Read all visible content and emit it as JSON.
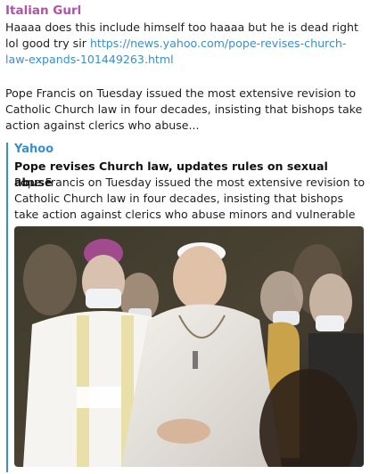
{
  "message": {
    "sender": "Italian Gurl",
    "text": "Haaaa does this include himself too haaaa but he is dead right lol good try sir",
    "link": "https://news.yahoo.com/pope-revises-church-law-expands-101449263.html",
    "paragraph": "Pope Francis on Tuesday issued the most extensive revision to Catholic Church law in four decades, insisting that bishops take action against clerics who abuse..."
  },
  "link_preview": {
    "site_name": "Yahoo",
    "title": "Pope revises Church law, updates rules on sexual abuse",
    "description": "Pope Francis on Tuesday issued the most extensive revision to Catholic Church law in four decades, insisting that bishops take action against clerics who abuse minors and vulnerable adults, c..."
  },
  "colors": {
    "sender": "#b452a8",
    "link": "#3a8fd0",
    "accent_bar": "#3a8fd0"
  }
}
